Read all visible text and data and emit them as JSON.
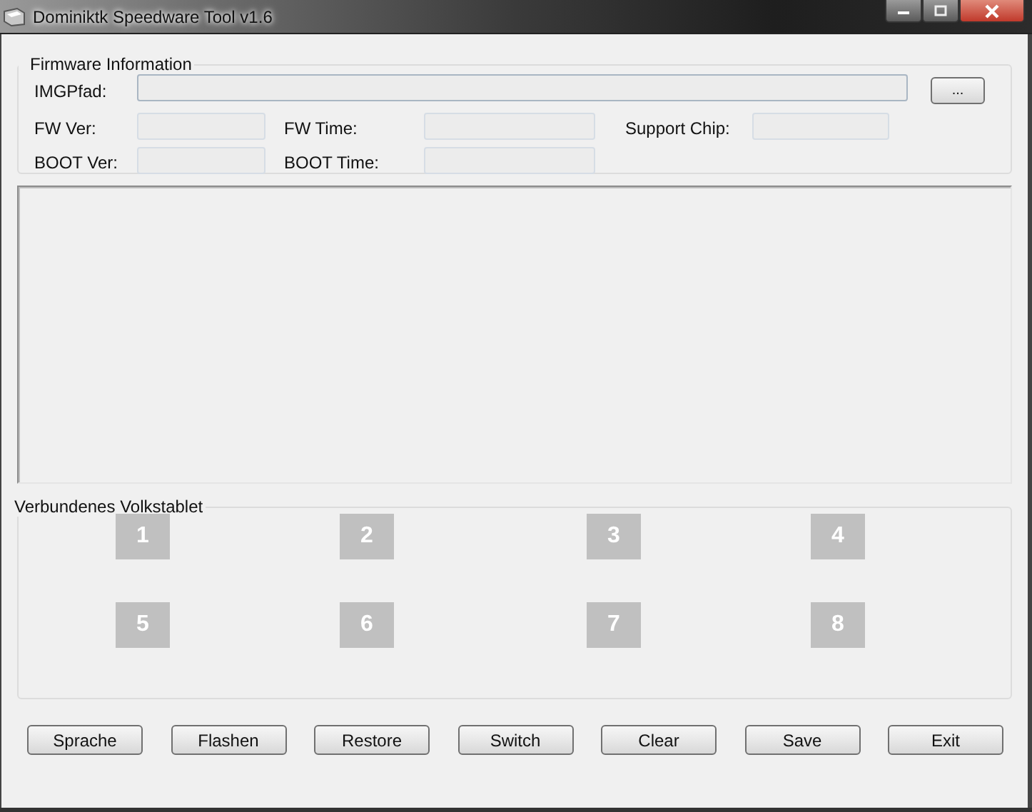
{
  "window": {
    "title": "Dominiktk Speedware Tool v1.6"
  },
  "firmware": {
    "title": "Firmware Information",
    "image_path": {
      "label": "IMGPfad:"
    },
    "browse_button": "...",
    "rows": [
      [
        {
          "label": "FW Ver:"
        },
        {
          "label": "FW Time:"
        },
        {
          "label": "Support Chip:"
        }
      ],
      [
        {
          "label": "BOOT Ver:"
        },
        {
          "label": "BOOT Time:"
        }
      ]
    ]
  },
  "devices": {
    "title": "Verbundenes Volkstablet",
    "slots": [
      "1",
      "2",
      "3",
      "4",
      "5",
      "6",
      "7",
      "8"
    ]
  },
  "buttons": [
    "Sprache",
    "Flashen",
    "Restore",
    "Switch",
    "Clear",
    "Save",
    "Exit"
  ]
}
